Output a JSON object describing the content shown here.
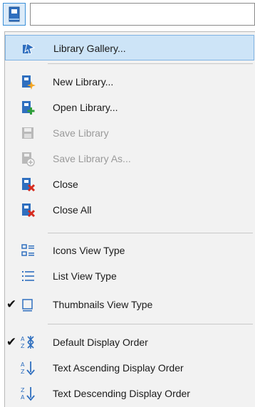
{
  "menu": {
    "items": [
      {
        "label": "Library Gallery...",
        "icon": "library-gallery-icon"
      },
      {
        "label": "New Library...",
        "icon": "new-library-icon"
      },
      {
        "label": "Open Library...",
        "icon": "open-library-icon"
      },
      {
        "label": "Save Library",
        "icon": "save-library-icon"
      },
      {
        "label": "Save Library As...",
        "icon": "save-library-as-icon"
      },
      {
        "label": "Close",
        "icon": "close-library-icon"
      },
      {
        "label": "Close All",
        "icon": "close-all-libraries-icon"
      },
      {
        "label": "Icons View Type",
        "icon": "icons-view-icon"
      },
      {
        "label": "List View Type",
        "icon": "list-view-icon"
      },
      {
        "label": "Thumbnails View Type",
        "icon": "thumbnails-view-icon"
      },
      {
        "label": "Default Display Order",
        "icon": "default-order-icon"
      },
      {
        "label": "Text Ascending Display Order",
        "icon": "sort-ascending-icon"
      },
      {
        "label": "Text Descending Display Order",
        "icon": "sort-descending-icon"
      }
    ]
  },
  "colors": {
    "accent_blue": "#2f6fbf",
    "highlight": "#cde4f7",
    "disabled_text": "#9a9a9a",
    "close_red": "#d62b1f",
    "new_orange": "#f5a623",
    "open_green": "#2e9e3a"
  },
  "state": {
    "highlighted_item": "Library Gallery...",
    "checked_items": [
      "Thumbnails View Type",
      "Default Display Order"
    ],
    "disabled_items": [
      "Save Library",
      "Save Library As..."
    ]
  }
}
